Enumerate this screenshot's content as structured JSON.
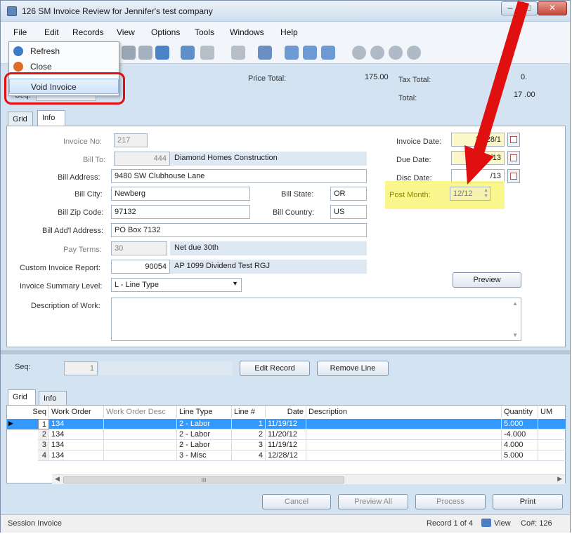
{
  "window": {
    "title": "126 SM Invoice Review for Jennifer's test company",
    "minimize": "–",
    "maximize": "□",
    "close": "✕"
  },
  "menubar": [
    "File",
    "Edit",
    "Records",
    "View",
    "Options",
    "Tools",
    "Windows",
    "Help"
  ],
  "file_menu": {
    "items": [
      "Refresh",
      "Close",
      "Void Invoice"
    ]
  },
  "header": {
    "price_total_label": "Price Total:",
    "price_total_value": "175.00",
    "tax_total_label": "Tax Total:",
    "tax_total_value": "0.",
    "total_label": "Total:",
    "total_value": "17 .00",
    "seq_label": "Seq:"
  },
  "upper_tabs": [
    "Grid",
    "Info"
  ],
  "info": {
    "invoice_no_label": "Invoice No:",
    "invoice_no": "217",
    "bill_to_label": "Bill To:",
    "bill_to_code": "444",
    "bill_to_name": "Diamond Homes Construction",
    "bill_address_label": "Bill Address:",
    "bill_address": "9480 SW Clubhouse Lane",
    "bill_city_label": "Bill City:",
    "bill_city": "Newberg",
    "bill_state_label": "Bill State:",
    "bill_state": "OR",
    "bill_zip_label": "Bill Zip Code:",
    "bill_zip": "97132",
    "bill_country_label": "Bill Country:",
    "bill_country": "US",
    "bill_addl_label": "Bill Add'l Address:",
    "bill_addl": "PO Box 7132",
    "pay_terms_label": "Pay Terms:",
    "pay_terms_code": "30",
    "pay_terms_desc": "Net due 30th",
    "custom_report_label": "Custom Invoice Report:",
    "custom_report_code": "90054",
    "custom_report_desc": "AP 1099 Dividend Test RGJ",
    "summary_level_label": "Invoice Summary Level:",
    "summary_level": "L - Line Type",
    "description_label": "Description of Work:",
    "invoice_date_label": "Invoice Date:",
    "invoice_date": "12/28/1",
    "due_date_label": "Due Date:",
    "due_date": "2/28/13",
    "disc_date_label": "Disc Date:",
    "disc_date": "/13",
    "post_month_label": "Post Month:",
    "post_month": "12/12",
    "preview_button": "Preview"
  },
  "lower": {
    "seq_label": "Seq:",
    "seq_value": "1",
    "edit_record": "Edit Record",
    "remove_line": "Remove Line"
  },
  "lower_tabs": [
    "Grid",
    "Info"
  ],
  "grid": {
    "columns": [
      "Seq",
      "Work Order",
      "Work Order Desc",
      "Line Type",
      "Line #",
      "Date",
      "Description",
      "Quantity",
      "UM"
    ],
    "rows": [
      {
        "seq": "1",
        "work_order": "134",
        "wo_desc": "",
        "line_type": "2 - Labor",
        "line_no": "1",
        "date": "11/19/12",
        "description": "",
        "quantity": "5.000",
        "um": ""
      },
      {
        "seq": "2",
        "work_order": "134",
        "wo_desc": "",
        "line_type": "2 - Labor",
        "line_no": "2",
        "date": "11/20/12",
        "description": "",
        "quantity": "-4.000",
        "um": ""
      },
      {
        "seq": "3",
        "work_order": "134",
        "wo_desc": "",
        "line_type": "2 - Labor",
        "line_no": "3",
        "date": "11/19/12",
        "description": "",
        "quantity": "4.000",
        "um": ""
      },
      {
        "seq": "4",
        "work_order": "134",
        "wo_desc": "",
        "line_type": "3 - Misc",
        "line_no": "4",
        "date": "12/28/12",
        "description": "",
        "quantity": "5.000",
        "um": ""
      }
    ],
    "scroll_grip": "III"
  },
  "bottom_buttons": [
    "Cancel",
    "Preview All",
    "Process",
    "Print"
  ],
  "status": {
    "left": "Session Invoice",
    "record": "Record 1 of 4",
    "view": "View",
    "company": "Co#: 126"
  },
  "colors": {
    "annotation_red": "#e01010",
    "highlight_yellow": "#f8f67a",
    "selection_blue": "#3399ff"
  }
}
